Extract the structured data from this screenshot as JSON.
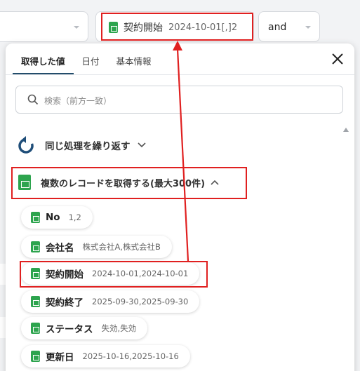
{
  "filter": {
    "field_name": "契約開始",
    "field_value": "2024-10-01[,]2",
    "operator": "and"
  },
  "tabs": [
    {
      "label": "取得した値",
      "active": true
    },
    {
      "label": "日付",
      "active": false
    },
    {
      "label": "基本情報",
      "active": false
    }
  ],
  "search": {
    "placeholder": "検索（前方一致）"
  },
  "repeat": {
    "label": "同じ処理を繰り返す"
  },
  "group": {
    "label": "複数のレコードを取得する(最大300件)"
  },
  "items": [
    {
      "name": "No",
      "value": "1,2"
    },
    {
      "name": "会社名",
      "value": "株式会社A,株式会社B"
    },
    {
      "name": "契約開始",
      "value": "2024-10-01,2024-10-01"
    },
    {
      "name": "契約終了",
      "value": "2025-09-30,2025-09-30"
    },
    {
      "name": "ステータス",
      "value": "失効,失効"
    },
    {
      "name": "更新日",
      "value": "2025-10-16,2025-10-16"
    }
  ],
  "colors": {
    "highlight": "#e02020",
    "sheet_icon": "#2da44e",
    "tab_underline": "#234d6b"
  }
}
